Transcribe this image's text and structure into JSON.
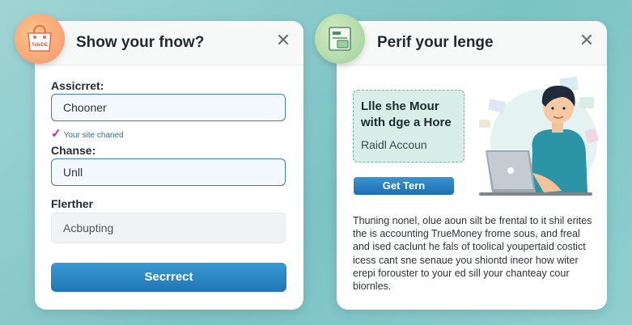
{
  "left_card": {
    "title": "Show your fnow?",
    "badge_text": "TeleDE",
    "fields": [
      {
        "label": "Assicrret:",
        "value": "Chooner"
      },
      {
        "label": "Chanse:",
        "value": "Unll"
      },
      {
        "label": "Flerther",
        "value": "Acbupting"
      }
    ],
    "validation": "Your site chaned",
    "submit_label": "Secrrect"
  },
  "right_card": {
    "title": "Perif your lenge",
    "promo_heading": "Llle she Mour with dge a Hore",
    "promo_sub": "Raidl Accoun",
    "button_label": "Get Tern",
    "description": "Thuning nonel, olue aoun silt be frental to it shil erites the is accounting TrueMoney frome sous, and freal and ised caclunt he fals of toolical youpertaid costict icess cant sne senaue you shiontd ineor how witer erepi forouster to your ed sill your chanteay cour biornles."
  },
  "icons": [
    "shopping-bag-icon",
    "close-icon",
    "checkmark-icon",
    "document-folder-icon",
    "laptop-person-illustration"
  ],
  "colors": {
    "accent": "#1f76b3",
    "promo_bg": "#d8efe9",
    "check": "#c322c3"
  }
}
